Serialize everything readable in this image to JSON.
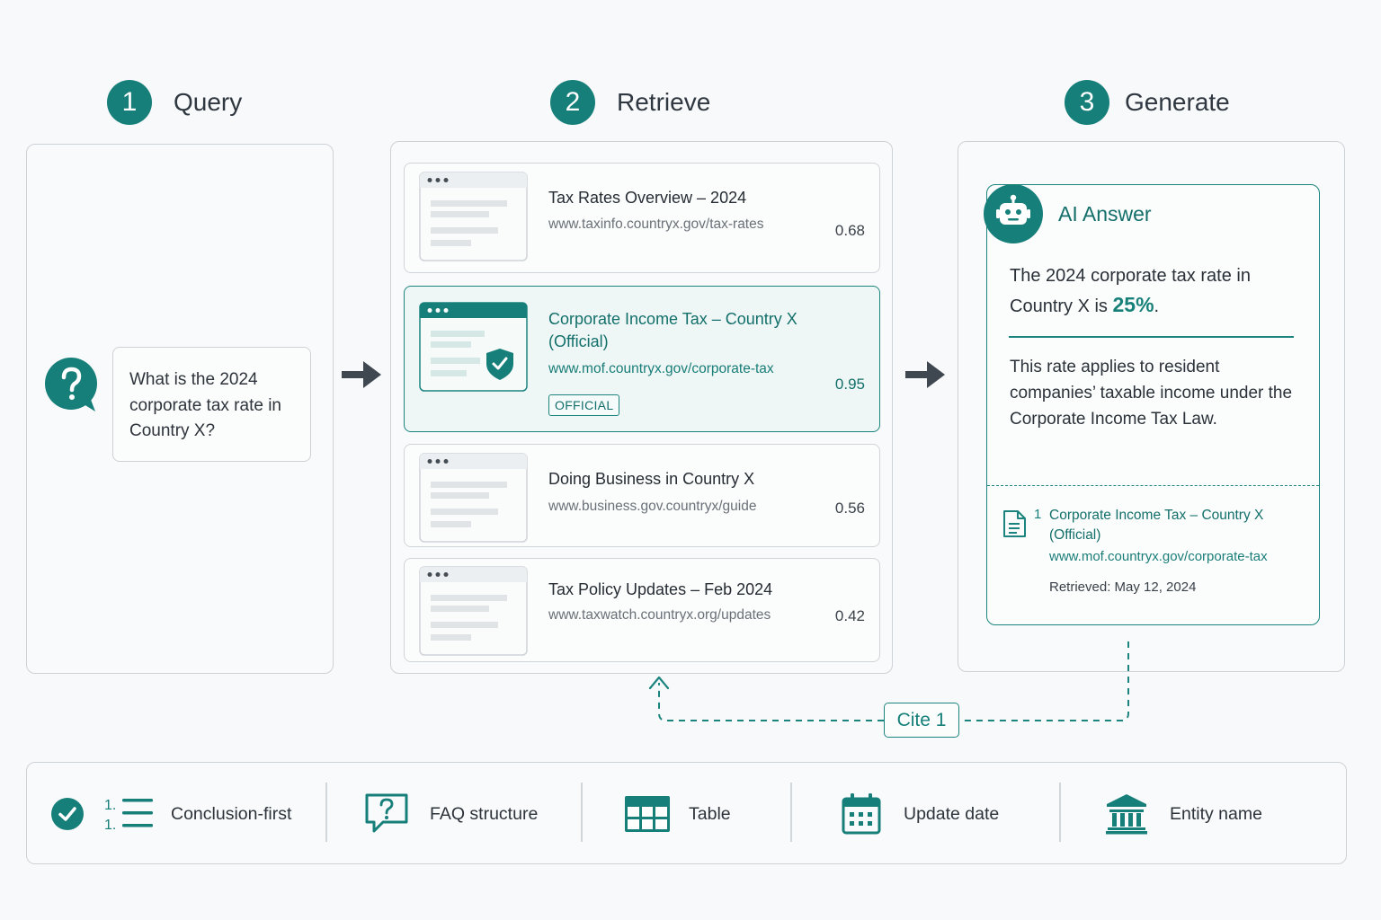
{
  "steps": [
    {
      "number": "1",
      "label": "Query"
    },
    {
      "number": "2",
      "label": "Retrieve"
    },
    {
      "number": "3",
      "label": "Generate"
    }
  ],
  "query": {
    "text": "What is the 2024 corporate tax rate in Country X?"
  },
  "results": [
    {
      "title": "Tax Rates Overview – 2024",
      "url": "www.taxinfo.countryx.gov/tax-rates",
      "score": "0.68"
    },
    {
      "title": "Corporate Income Tax – Country X (Official)",
      "url": "www.mof.countryx.gov/corporate-tax",
      "score": "0.95",
      "badge": "OFFICIAL"
    },
    {
      "title": "Doing Business in Country X",
      "url": "www.business.gov.countryx/guide",
      "score": "0.56"
    },
    {
      "title": "Tax Policy Updates – Feb 2024",
      "url": "www.taxwatch.countryx.org/updates",
      "score": "0.42"
    }
  ],
  "answer": {
    "title": "AI Answer",
    "main_prefix": "The 2024 corporate tax rate in Country X is",
    "rate": "25%",
    "main_suffix": ".",
    "detail": "This rate applies to resident companies’ taxable income under the Corporate Income Tax Law.",
    "citation": {
      "number": "1",
      "title": "Corporate Income Tax – Country X (Official)",
      "url": "www.mof.countryx.gov/corporate-tax",
      "retrieved": "Retrieved: May 12, 2024"
    }
  },
  "cite_link": "Cite 1",
  "features": [
    {
      "label": "Conclusion-first",
      "icon": "check-circle-icon"
    },
    {
      "label": "FAQ structure",
      "icon": "question-bubble-icon"
    },
    {
      "label": "Table",
      "icon": "table-icon"
    },
    {
      "label": "Update date",
      "icon": "calendar-icon"
    },
    {
      "label": "Entity name",
      "icon": "bank-building-icon"
    }
  ],
  "colors": {
    "accent": "#167f7a",
    "border": "#cdd2d7",
    "background": "#f8f9fa",
    "highlight": "#eef7f6"
  }
}
